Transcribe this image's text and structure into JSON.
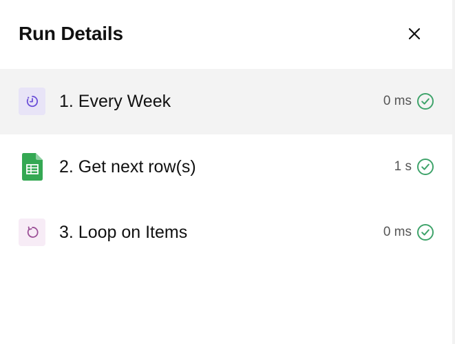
{
  "header": {
    "title": "Run Details"
  },
  "steps": [
    {
      "label": "1. Every Week",
      "duration": "0 ms",
      "icon": "clock-schedule-icon",
      "status": "success",
      "selected": true
    },
    {
      "label": "2. Get next row(s)",
      "duration": "1 s",
      "icon": "google-sheets-icon",
      "status": "success",
      "selected": false
    },
    {
      "label": "3. Loop on Items",
      "duration": "0 ms",
      "icon": "loop-icon",
      "status": "success",
      "selected": false
    }
  ],
  "colors": {
    "success": "#3ea36a",
    "trigger_icon": "#6b4fd8",
    "trigger_bg": "#e8e4f7",
    "sheets_green": "#34a853",
    "loop_icon": "#9b4f96",
    "loop_bg": "#f7ecf6",
    "selected_row_bg": "#f3f3f3"
  }
}
